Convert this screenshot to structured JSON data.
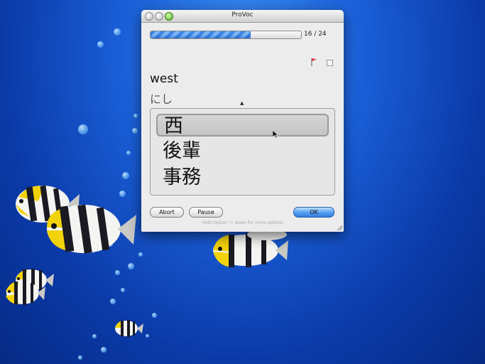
{
  "window": {
    "title": "ProVoc"
  },
  "progress": {
    "text": "16 / 24",
    "current": 16,
    "total": 24
  },
  "question": {
    "word": "west",
    "reading": "にし"
  },
  "choices": [
    {
      "label": "西",
      "selected": true
    },
    {
      "label": "後輩",
      "selected": false
    },
    {
      "label": "事務",
      "selected": false
    }
  ],
  "buttons": {
    "abort": "Abort",
    "pause": "Pause",
    "ok": "OK"
  },
  "hint": "Hold Option ⌥ down for more options",
  "icons": {
    "flag": "flag-icon",
    "mark": "checkbox-icon"
  },
  "colors": {
    "accent": "#3f86e6",
    "desktop": "#1a5fd8"
  }
}
